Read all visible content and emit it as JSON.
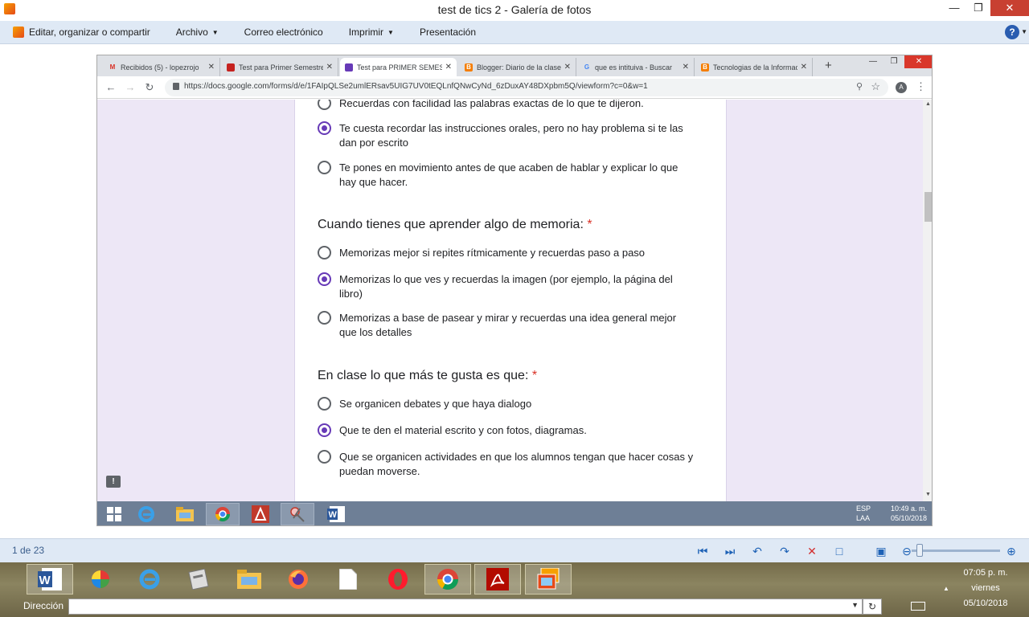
{
  "gallery": {
    "title": "test de tics 2 - Galería de fotos",
    "menu": [
      {
        "label": "Editar, organizar o compartir",
        "caret": false
      },
      {
        "label": "Archivo",
        "caret": true
      },
      {
        "label": "Correo electrónico",
        "caret": false
      },
      {
        "label": "Imprimir",
        "caret": true
      },
      {
        "label": "Presentación",
        "caret": false
      }
    ],
    "help": "?",
    "page_indicator": "1 de 23"
  },
  "browser": {
    "tabs": [
      {
        "title": "Recibidos (5) - lopezrojo",
        "icon": "gmail-icon",
        "color": "#d93025",
        "glyph": "M"
      },
      {
        "title": "Test para Primer Semestre",
        "icon": "form-tab-icon",
        "color": "#c5221f",
        "glyph": ""
      },
      {
        "title": "Test para PRIMER SEMESTRE",
        "icon": "forms-icon",
        "color": "#673ab7",
        "glyph": ""
      },
      {
        "title": "Blogger: Diario de la clase",
        "icon": "blogger-icon",
        "color": "#f57d00",
        "glyph": "B"
      },
      {
        "title": "que es intituiva - Buscar",
        "icon": "google-icon",
        "color": "#4285f4",
        "glyph": "G"
      },
      {
        "title": "Tecnologias de la Información",
        "icon": "blogger-icon",
        "color": "#f57d00",
        "glyph": "B"
      }
    ],
    "url": "https://docs.google.com/forms/d/e/1FAIpQLSe2umlERsav5UIG7UV0tEQLnfQNwCyNd_6zDuxAY48DXpbm5Q/viewform?c=0&w=1",
    "avatar_letter": "A"
  },
  "form": {
    "prev_options": [
      {
        "label": "Recuerdas con facilidad las palabras exactas de lo que te dijeron.",
        "checked": false
      },
      {
        "label": "Te cuesta recordar las instrucciones orales, pero no hay problema si te las dan por escrito",
        "checked": true
      },
      {
        "label": "Te pones en movimiento antes de que acaben de hablar y explicar lo que hay que hacer.",
        "checked": false
      }
    ],
    "q2": {
      "title": "Cuando tienes que aprender algo de memoria:",
      "required": "*",
      "options": [
        {
          "label": "Memorizas mejor si repites rítmicamente y recuerdas paso a paso",
          "checked": false
        },
        {
          "label": "Memorizas lo que ves y recuerdas la imagen (por ejemplo, la página del libro)",
          "checked": true
        },
        {
          "label": "Memorizas a base de pasear y mirar y recuerdas una idea general mejor que los detalles",
          "checked": false
        }
      ]
    },
    "q3": {
      "title": "En clase lo que más te gusta es que:",
      "required": "*",
      "options": [
        {
          "label": "Se organicen debates y que haya dialogo",
          "checked": false
        },
        {
          "label": "Que te den el material escrito y con fotos, diagramas.",
          "checked": true
        },
        {
          "label": "Que se organicen actividades en que los alumnos tengan que hacer cosas y puedan moverse.",
          "checked": false
        }
      ]
    },
    "accent": "#673ab7"
  },
  "inner_taskbar": {
    "lang": "ESP",
    "layout": "LAA",
    "time": "10:49 a. m.",
    "date": "05/10/2018"
  },
  "desktop": {
    "address_label": "Dirección",
    "time": "07:05 p. m.",
    "day": "viernes",
    "date": "05/10/2018"
  }
}
